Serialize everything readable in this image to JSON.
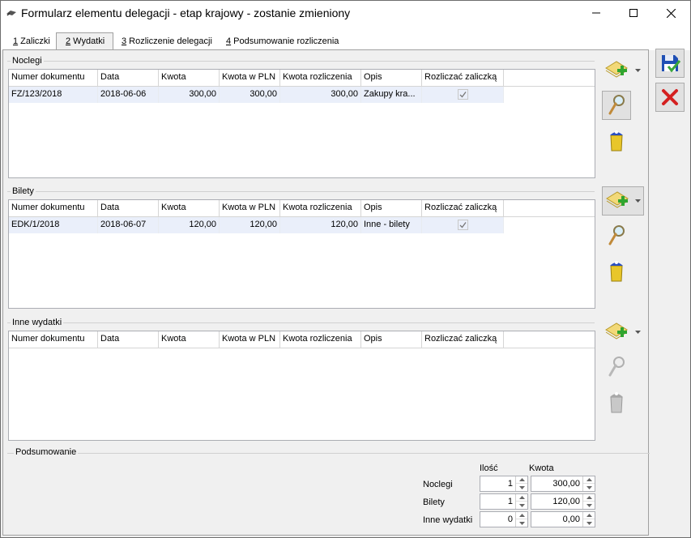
{
  "window": {
    "title": "Formularz elementu delegacji - etap krajowy - zostanie zmieniony"
  },
  "tabs": [
    {
      "num": "1",
      "label": " Zaliczki"
    },
    {
      "num": "2",
      "label": " Wydatki"
    },
    {
      "num": "3",
      "label": " Rozliczenie delegacji"
    },
    {
      "num": "4",
      "label": " Podsumowanie rozliczenia"
    }
  ],
  "columns": [
    "Numer dokumentu",
    "Data",
    "Kwota",
    "Kwota w PLN",
    "Kwota rozliczenia",
    "Opis",
    "Rozliczać zaliczką"
  ],
  "noclegi": {
    "title": "Noclegi",
    "rows": [
      {
        "numer": "FZ/123/2018",
        "data": "2018-06-06",
        "kwota": "300,00",
        "kwota_pln": "300,00",
        "kwota_rozl": "300,00",
        "opis": "Zakupy kra...",
        "rozliczac": true
      }
    ]
  },
  "bilety": {
    "title": "Bilety",
    "rows": [
      {
        "numer": "EDK/1/2018",
        "data": "2018-06-07",
        "kwota": "120,00",
        "kwota_pln": "120,00",
        "kwota_rozl": "120,00",
        "opis": "Inne - bilety",
        "rozliczac": true
      }
    ]
  },
  "inne": {
    "title": "Inne wydatki",
    "rows": []
  },
  "summary": {
    "title": "Podsumowanie",
    "col_ilosc": "Ilość",
    "col_kwota": "Kwota",
    "rows": [
      {
        "label": "Noclegi",
        "ilosc": "1",
        "kwota": "300,00"
      },
      {
        "label": "Bilety",
        "ilosc": "1",
        "kwota": "120,00"
      },
      {
        "label": "Inne wydatki",
        "ilosc": "0",
        "kwota": "0,00"
      }
    ]
  },
  "colors": {
    "selected_row": "#eaeffa",
    "save_blue": "#1f4fb4",
    "cancel_red": "#d42020"
  }
}
